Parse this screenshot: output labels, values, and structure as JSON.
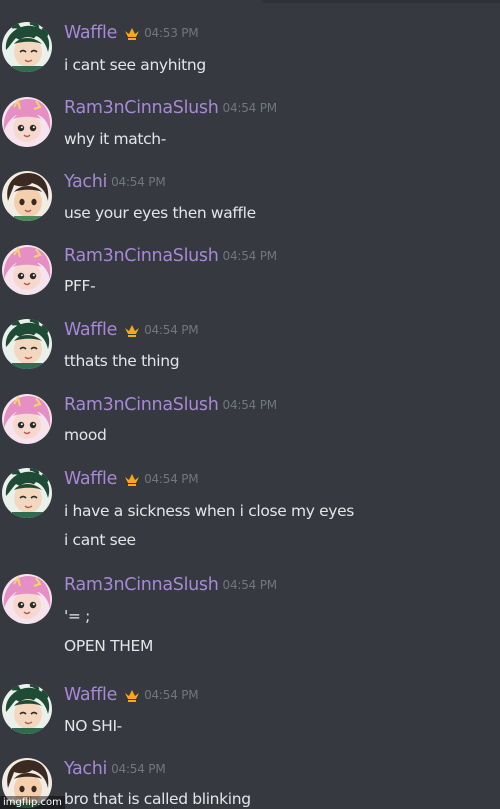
{
  "users": {
    "waffle": {
      "name": "Waffle",
      "name_color": "#a789d6",
      "crown_color": "#faa81a"
    },
    "ram": {
      "name": "Ram3nCinnaSlush",
      "name_color": "#a789d6"
    },
    "yachi": {
      "name": "Yachi",
      "name_color": "#a789d6"
    }
  },
  "messages": [
    {
      "author": "Waffle",
      "timestamp": "04:53 PM",
      "lines": [
        "i cant see anyhitng"
      ]
    },
    {
      "author": "Ram3nCinnaSlush",
      "timestamp": "04:54 PM",
      "lines": [
        "why it match-"
      ]
    },
    {
      "author": "Yachi",
      "timestamp": "04:54 PM",
      "lines": [
        "use your eyes then waffle"
      ]
    },
    {
      "author": "Ram3nCinnaSlush",
      "timestamp": "04:54 PM",
      "lines": [
        "PFF-"
      ]
    },
    {
      "author": "Waffle",
      "timestamp": "04:54 PM",
      "lines": [
        "tthats the thing"
      ]
    },
    {
      "author": "Ram3nCinnaSlush",
      "timestamp": "04:54 PM",
      "lines": [
        "mood"
      ]
    },
    {
      "author": "Waffle",
      "timestamp": "04:54 PM",
      "lines": [
        "i have a sickness when i close my eyes",
        "i cant see"
      ]
    },
    {
      "author": "Ram3nCinnaSlush",
      "timestamp": "04:54 PM",
      "lines": [
        "'= ;",
        "OPEN THEM"
      ]
    },
    {
      "author": "Waffle",
      "timestamp": "04:54 PM",
      "lines": [
        "NO SHI-"
      ]
    },
    {
      "author": "Yachi",
      "timestamp": "04:54 PM",
      "lines": [
        "bro that is called blinking"
      ]
    }
  ],
  "watermark": "imgflip.com",
  "colors": {
    "background": "#36393f",
    "message_text": "#e3e5e8",
    "timestamp": "#72767d",
    "username": "#a789d6",
    "crown": "#faa81a"
  },
  "icons": {
    "crown": "crown-icon",
    "waffle_avatar": "green-hair-boy-avatar",
    "ram_avatar": "pink-hair-girl-avatar",
    "yachi_avatar": "brown-hair-boy-avatar"
  }
}
